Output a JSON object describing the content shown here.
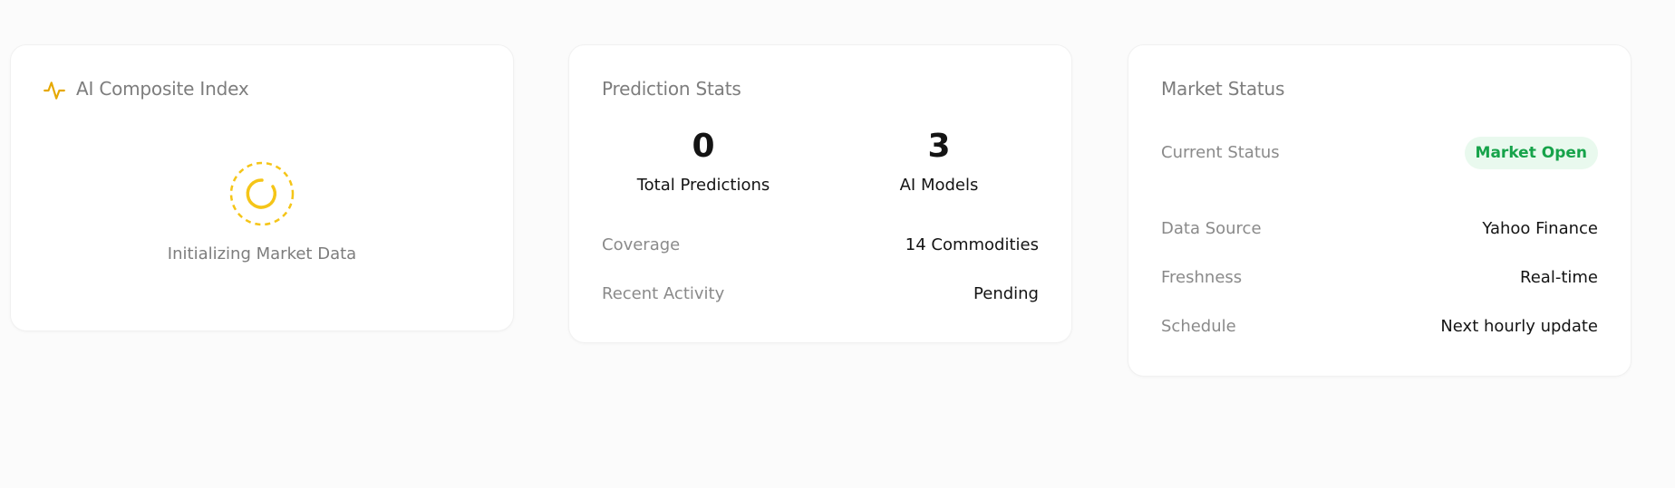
{
  "composite": {
    "title": "AI Composite Index",
    "icon": "pulse-icon",
    "loading_text": "Initializing Market Data",
    "accent_color": "#f5c518"
  },
  "stats": {
    "title": "Prediction Stats",
    "total_predictions": {
      "value": "0",
      "label": "Total Predictions"
    },
    "ai_models": {
      "value": "3",
      "label": "AI Models"
    },
    "coverage": {
      "label": "Coverage",
      "value": "14 Commodities"
    },
    "recent_activity": {
      "label": "Recent Activity",
      "value": "Pending"
    }
  },
  "market": {
    "title": "Market Status",
    "current_status": {
      "label": "Current Status",
      "value": "Market Open",
      "color": "#16a34a"
    },
    "data_source": {
      "label": "Data Source",
      "value": "Yahoo Finance"
    },
    "freshness": {
      "label": "Freshness",
      "value": "Real-time"
    },
    "schedule": {
      "label": "Schedule",
      "value": "Next hourly update"
    }
  }
}
